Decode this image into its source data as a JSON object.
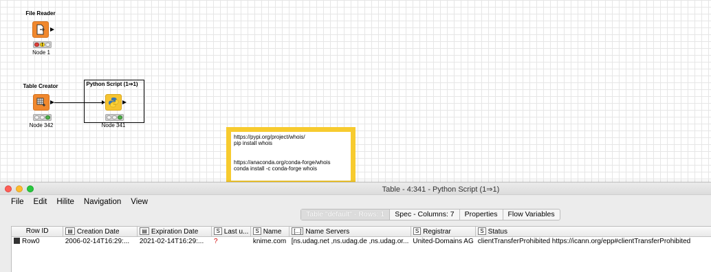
{
  "workflow": {
    "file_reader": {
      "title": "File Reader",
      "label": "Node 1",
      "warning": "!"
    },
    "table_creator": {
      "title": "Table Creator",
      "label": "Node 342"
    },
    "python_script": {
      "title": "Python Script (1⇒1)",
      "label": "Node 341"
    },
    "annotation": {
      "lines": [
        "https://pypi.org/project/whois/",
        "pip install whois",
        "",
        "https://anaconda.org/conda-forge/whois",
        "conda install -c conda-forge whois"
      ]
    }
  },
  "window": {
    "title": "Table - 4:341 - Python Script (1⇒1)",
    "menu": [
      "File",
      "Edit",
      "Hilite",
      "Navigation",
      "View"
    ],
    "tabs": [
      {
        "label": "Table \"default\" - Rows: 1",
        "active": true
      },
      {
        "label": "Spec - Columns: 7",
        "active": false
      },
      {
        "label": "Properties",
        "active": false
      },
      {
        "label": "Flow Variables",
        "active": false
      }
    ],
    "table": {
      "columns": [
        {
          "type": "",
          "name": "Row ID"
        },
        {
          "type": "date-icon",
          "name": "Creation Date"
        },
        {
          "type": "date-icon",
          "name": "Expiration Date"
        },
        {
          "type": "S",
          "name": "Last u..."
        },
        {
          "type": "S",
          "name": "Name"
        },
        {
          "type": "[...]",
          "name": "Name Servers"
        },
        {
          "type": "S",
          "name": "Registrar"
        },
        {
          "type": "S",
          "name": "Status"
        }
      ],
      "rows": [
        {
          "row_id": "Row0",
          "creation_date": "2006-02-14T16:29:...",
          "expiration_date": "2021-02-14T16:29:...",
          "last_updated": "?",
          "name": "knime.com",
          "name_servers": "[ns.udag.net ,ns.udag.de ,ns.udag.or...",
          "registrar": "United-Domains AG",
          "status": "clientTransferProhibited https://icann.org/epp#clientTransferProhibited"
        }
      ]
    }
  }
}
